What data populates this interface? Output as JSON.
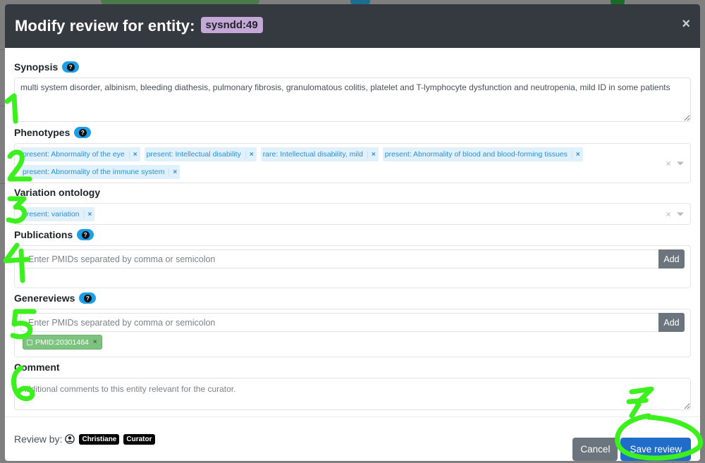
{
  "modal": {
    "title": "Modify review for entity:",
    "entity_id": "sysndd:49",
    "close_label": "×"
  },
  "synopsis": {
    "label": "Synopsis",
    "help": "?",
    "value": "multi system disorder, albinism, bleeding diathesis, pulmonary fibrosis, granulomatous colitis, platelet and T-lymphocyte dysfunction and neutropenia, mild ID in some patients"
  },
  "phenotypes": {
    "label": "Phenotypes",
    "help": "?",
    "tags": [
      "present: Abnormality of the eye",
      "present: Intellectual disability",
      "rare: Intellectual disability, mild",
      "present: Abnormality of blood and blood-forming tissues",
      "present: Abnormality of the immune system"
    ],
    "remove": "×",
    "clear": "×"
  },
  "variation": {
    "label": "Variation ontology",
    "tags": [
      "present: variation"
    ],
    "remove": "×",
    "clear": "×"
  },
  "publications": {
    "label": "Publications",
    "help": "?",
    "placeholder": "Enter PMIDs separated by comma or semicolon",
    "add_label": "Add"
  },
  "genereviews": {
    "label": "Genereviews",
    "help": "?",
    "placeholder": "Enter PMIDs separated by comma or semicolon",
    "add_label": "Add",
    "chips": [
      "PMID:20301464"
    ],
    "remove": "×"
  },
  "comment": {
    "label": "Comment",
    "placeholder": "Additional comments to this entity relevant for the curator."
  },
  "footer": {
    "review_by_label": "Review by:",
    "user_name": "Christiane",
    "user_role": "Curator",
    "cancel_label": "Cancel",
    "save_label": "Save review"
  },
  "annotations": {
    "color": "#3cf01e",
    "labels": [
      "1",
      "2",
      "3",
      "4",
      "5",
      "6",
      "7"
    ]
  }
}
